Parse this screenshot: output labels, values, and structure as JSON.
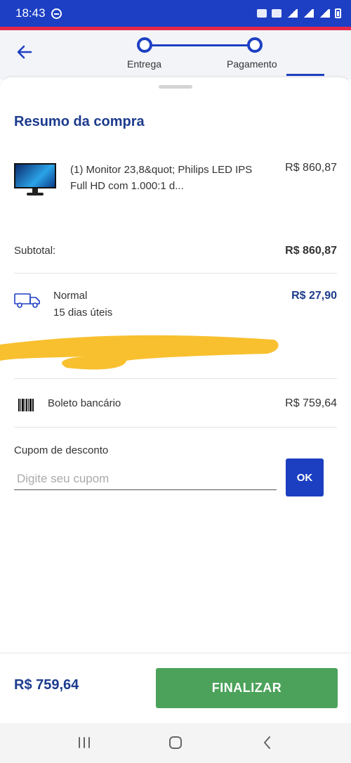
{
  "status_bar": {
    "time": "18:43"
  },
  "header": {
    "steps": [
      {
        "label": "Entrega"
      },
      {
        "label": "Pagamento"
      }
    ]
  },
  "summary": {
    "title": "Resumo da compra",
    "product": {
      "name": "(1) Monitor 23,8&quot; Philips LED IPS Full HD com 1.000:1 d...",
      "price": "R$ 860,87"
    },
    "subtotal_label": "Subtotal:",
    "subtotal_value": "R$ 860,87",
    "shipping": {
      "name": "Normal",
      "days": "15 dias úteis",
      "price": "R$ 27,90"
    },
    "payment": {
      "label": "Boleto bancário",
      "value": "R$ 759,64"
    },
    "coupon": {
      "label": "Cupom de desconto",
      "placeholder": "Digite seu cupom",
      "button": "OK"
    }
  },
  "footer": {
    "total": "R$ 759,64",
    "finalize_label": "FINALIZAR"
  },
  "colors": {
    "brand_blue": "#1d3fc4",
    "title_blue": "#1c3b8d",
    "finalize_green": "#4ca25a",
    "accent_red": "#e5284a",
    "redaction_yellow": "#f8c02e"
  }
}
